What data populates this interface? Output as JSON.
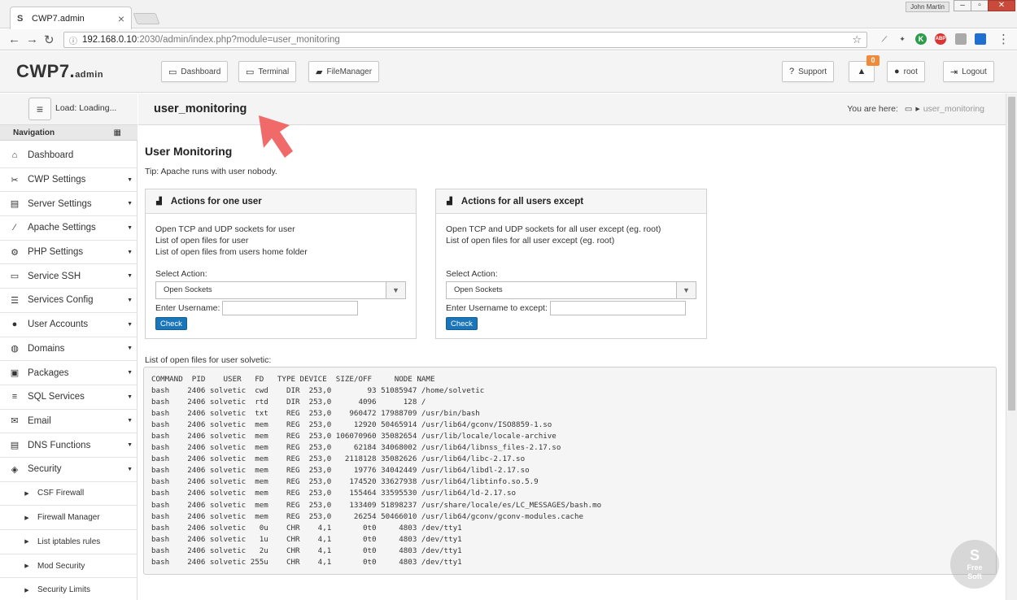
{
  "browser": {
    "tab_title": "CWP7.admin",
    "tab_favicon": "S",
    "profile_name": "John Martin",
    "url_host": "192.168.0.10",
    "url_path": ":2030/admin/index.php?module=user_monitoring",
    "extensions": [
      "K",
      "ABP"
    ]
  },
  "header": {
    "logo": "CWP7.",
    "logo_small": "admin",
    "buttons": {
      "dashboard": "Dashboard",
      "terminal": "Terminal",
      "filemanager": "FileManager",
      "support": "Support",
      "user": "root",
      "logout": "Logout"
    },
    "notification_count": "0"
  },
  "sidebar": {
    "load_text": "Load: Loading...",
    "nav_title": "Navigation",
    "items": [
      {
        "label": "Dashboard",
        "icon": "home-icon"
      },
      {
        "label": "CWP Settings",
        "icon": "wrench-icon"
      },
      {
        "label": "Server Settings",
        "icon": "server-icon"
      },
      {
        "label": "Apache Settings",
        "icon": "feather-icon"
      },
      {
        "label": "PHP Settings",
        "icon": "gear-icon"
      },
      {
        "label": "Service SSH",
        "icon": "monitor-icon"
      },
      {
        "label": "Services Config",
        "icon": "list-icon"
      },
      {
        "label": "User Accounts",
        "icon": "user-icon"
      },
      {
        "label": "Domains",
        "icon": "globe-icon"
      },
      {
        "label": "Packages",
        "icon": "package-icon"
      },
      {
        "label": "SQL Services",
        "icon": "database-icon"
      },
      {
        "label": "Email",
        "icon": "envelope-icon"
      },
      {
        "label": "DNS Functions",
        "icon": "dns-icon"
      },
      {
        "label": "Security",
        "icon": "shield-icon"
      }
    ],
    "security_sub": [
      "CSF Firewall",
      "Firewall Manager",
      "List iptables rules",
      "Mod Security",
      "Security Limits"
    ]
  },
  "page": {
    "title": "user_monitoring",
    "breadcrumb_label": "You are here:",
    "breadcrumb_current": "user_monitoring",
    "heading": "User Monitoring",
    "tip": "Tip: Apache runs with user nobody."
  },
  "panel_one": {
    "title": "Actions for one user",
    "lines": [
      "Open TCP and UDP sockets for user",
      "List of open files for user",
      "List of open files from users home folder"
    ],
    "select_label": "Select Action:",
    "select_value": "Open Sockets",
    "username_label": "Enter Username:",
    "check_label": "Check"
  },
  "panel_all": {
    "title": "Actions for all users except",
    "lines": [
      "Open TCP and UDP sockets for all user except (eg. root)",
      "List of open files for all user except (eg. root)"
    ],
    "select_label": "Select Action:",
    "select_value": "Open Sockets",
    "username_label": "Enter Username to except:",
    "check_label": "Check"
  },
  "files": {
    "label": "List of open files for user solvetic:",
    "output": "COMMAND  PID    USER   FD   TYPE DEVICE  SIZE/OFF     NODE NAME\nbash    2406 solvetic  cwd    DIR  253,0        93 51085947 /home/solvetic\nbash    2406 solvetic  rtd    DIR  253,0      4096      128 /\nbash    2406 solvetic  txt    REG  253,0    960472 17988709 /usr/bin/bash\nbash    2406 solvetic  mem    REG  253,0     12920 50465914 /usr/lib64/gconv/ISO8859-1.so\nbash    2406 solvetic  mem    REG  253,0 106070960 35082654 /usr/lib/locale/locale-archive\nbash    2406 solvetic  mem    REG  253,0     62184 34068002 /usr/lib64/libnss_files-2.17.so\nbash    2406 solvetic  mem    REG  253,0   2118128 35082626 /usr/lib64/libc-2.17.so\nbash    2406 solvetic  mem    REG  253,0     19776 34042449 /usr/lib64/libdl-2.17.so\nbash    2406 solvetic  mem    REG  253,0    174520 33627938 /usr/lib64/libtinfo.so.5.9\nbash    2406 solvetic  mem    REG  253,0    155464 33595530 /usr/lib64/ld-2.17.so\nbash    2406 solvetic  mem    REG  253,0    133409 51898237 /usr/share/locale/es/LC_MESSAGES/bash.mo\nbash    2406 solvetic  mem    REG  253,0     26254 50466010 /usr/lib64/gconv/gconv-modules.cache\nbash    2406 solvetic   0u    CHR    4,1       0t0     4803 /dev/tty1\nbash    2406 solvetic   1u    CHR    4,1       0t0     4803 /dev/tty1\nbash    2406 solvetic   2u    CHR    4,1       0t0     4803 /dev/tty1\nbash    2406 solvetic 255u    CHR    4,1       0t0     4803 /dev/tty1"
  },
  "watermark": {
    "top": "S",
    "text": "Free\nSoft"
  },
  "colors": {
    "accent": "#1a76b8",
    "badge": "#f0893a",
    "arrow": "#f16a6a"
  }
}
